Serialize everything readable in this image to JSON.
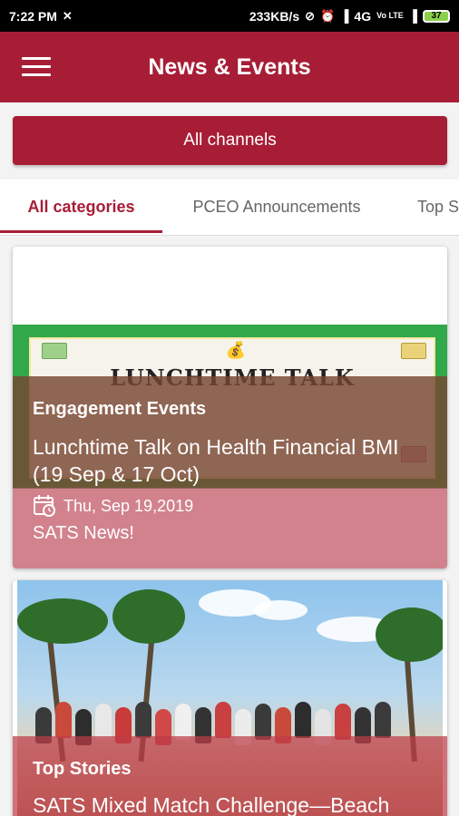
{
  "status_bar": {
    "time": "7:22 PM",
    "speed": "233KB/s",
    "network": "4G",
    "volte": "Vo LTE",
    "battery": "37"
  },
  "app_bar": {
    "title": "News & Events"
  },
  "channels_button": {
    "label": "All channels"
  },
  "tabs": [
    {
      "label": "All categories",
      "active": true
    },
    {
      "label": "PCEO Announcements",
      "active": false
    },
    {
      "label": "Top S",
      "active": false
    }
  ],
  "cards": [
    {
      "banner_title": "LUNCHTIME TALK",
      "category": "Engagement Events",
      "headline": "Lunchtime Talk on Health Financial BMI (19 Sep & 17 Oct)",
      "date": "Thu, Sep 19,2019",
      "source": "SATS News!"
    },
    {
      "category": "Top Stories",
      "headline": "SATS Mixed Match Challenge—Beach"
    }
  ],
  "colors": {
    "brand": "#a71d36",
    "banner_green": "#31a84a"
  }
}
